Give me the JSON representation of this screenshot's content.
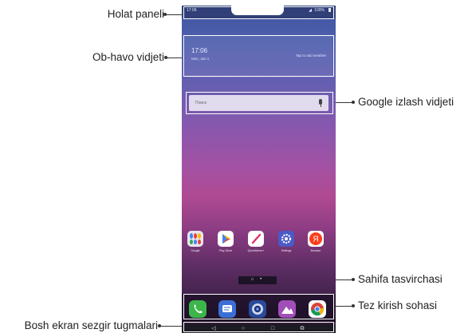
{
  "callouts": {
    "status_bar": "Holat paneli",
    "weather_widget": "Ob-havo vidjeti",
    "google_search_widget": "Google izlash vidjeti",
    "page_indicator": "Sahifa tasvirchasi",
    "quick_access": "Tez kirish sohasi",
    "home_touch_buttons": "Bosh ekran sezgir tugmalari"
  },
  "status_bar": {
    "time": "17:06",
    "battery": "100%"
  },
  "weather_widget": {
    "time": "17:06",
    "date": "Mon, Jan 1",
    "hint": "Tap to add weather"
  },
  "search": {
    "placeholder": "Поиск"
  },
  "apps": [
    {
      "label": "Google",
      "icon": "folder-icon",
      "color": "#e8e6f0"
    },
    {
      "label": "Play Store",
      "icon": "play-store-icon",
      "color": "#ffffff"
    },
    {
      "label": "QuickMemo+",
      "icon": "pencil-icon",
      "color": "#ffffff"
    },
    {
      "label": "Settings",
      "icon": "gear-icon",
      "color": "#4a5bc7"
    },
    {
      "label": "Browser",
      "icon": "yandex-icon",
      "color": "#ffffff"
    }
  ],
  "page_indicator": {
    "text": "⌂ •"
  },
  "dock": [
    {
      "icon": "phone-icon",
      "color": "#3cb54a"
    },
    {
      "icon": "messages-icon",
      "color": "#3b6fd6"
    },
    {
      "icon": "camera-icon",
      "color": "#2a4a9a"
    },
    {
      "icon": "gallery-icon",
      "color": "#a04fb8"
    },
    {
      "icon": "chrome-icon",
      "color": "#ffffff"
    }
  ],
  "nav": {
    "back": "◁",
    "home": "○",
    "recent": "□",
    "extra": "⧉"
  },
  "colors": {
    "frame": "#ffffff",
    "leader": "#333333"
  }
}
